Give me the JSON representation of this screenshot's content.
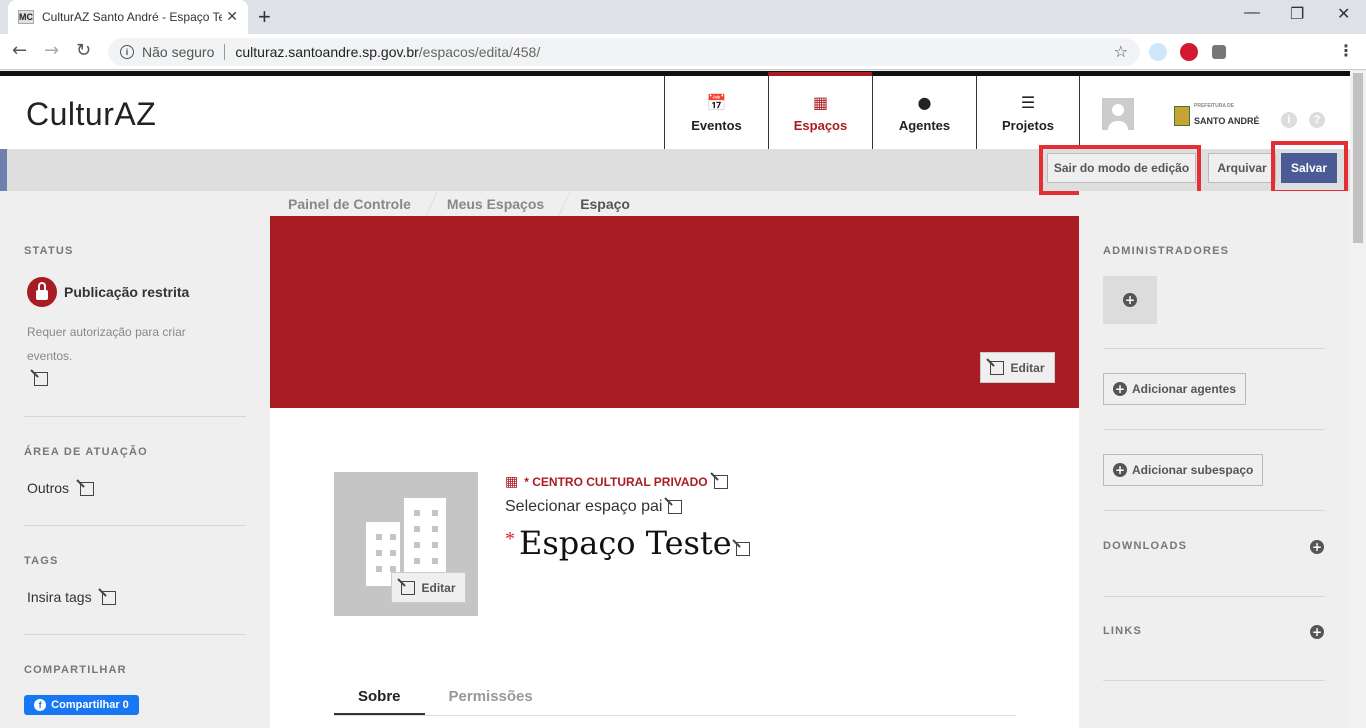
{
  "browser": {
    "tab_title": "CulturAZ Santo André - Espaço Te",
    "favicon": "MC",
    "security_label": "Não seguro",
    "url_host": "culturaz.santoandre.sp.gov.br",
    "url_path": "/espacos/edita/458/"
  },
  "header": {
    "logo": "CulturAZ",
    "nav": [
      {
        "label": "Eventos",
        "icon": "calendar-icon"
      },
      {
        "label": "Espaços",
        "icon": "building-icon"
      },
      {
        "label": "Agentes",
        "icon": "person-icon"
      },
      {
        "label": "Projetos",
        "icon": "document-icon"
      }
    ],
    "partner_logo_small": "PREFEITURA DE",
    "partner_logo": "SANTO ANDRÉ",
    "accent_color": "#aa1c24"
  },
  "toolbar": {
    "exit_edit_label": "Sair do modo de edição",
    "archive_label": "Arquivar",
    "save_label": "Salvar"
  },
  "left": {
    "status_title": "STATUS",
    "status_value": "Publicação restrita",
    "status_desc": "Requer autorização para criar eventos.",
    "area_title": "ÁREA DE ATUAÇÃO",
    "area_value": "Outros",
    "tags_title": "TAGS",
    "tags_placeholder": "Insira tags",
    "share_title": "COMPARTILHAR",
    "share_button": "Compartilhar 0"
  },
  "breadcrumb": [
    "Painel de Controle",
    "Meus Espaços",
    "Espaço"
  ],
  "main": {
    "cover_edit": "Editar",
    "avatar_edit": "Editar",
    "type_label": "* CENTRO CULTURAL PRIVADO",
    "parent_space": "Selecionar espaço pai",
    "required_mark": "*",
    "title": "Espaço Teste",
    "tabs": [
      "Sobre",
      "Permissões"
    ]
  },
  "right": {
    "admins_title": "ADMINISTRADORES",
    "add_agents": "Adicionar agentes",
    "add_subspace": "Adicionar subespaço",
    "downloads_title": "DOWNLOADS",
    "links_title": "LINKS"
  }
}
